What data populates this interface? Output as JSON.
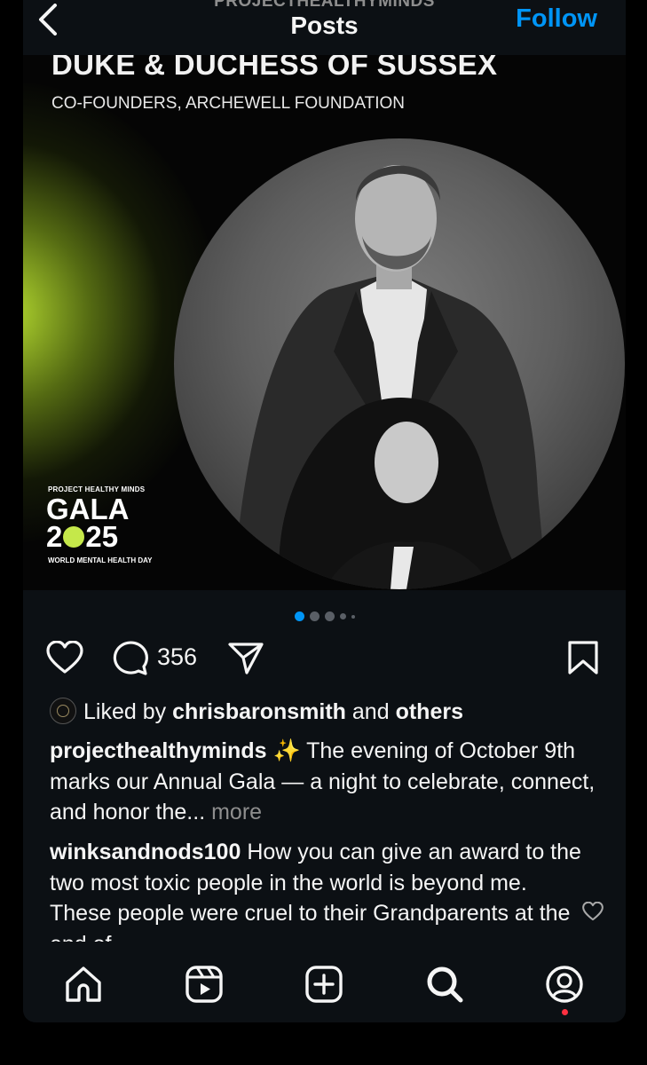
{
  "header": {
    "account_name": "PROJECTHEALTHYMINDS",
    "title": "Posts",
    "follow_label": "Follow"
  },
  "post_image": {
    "title": "DUKE & DUCHESS OF SUSSEX",
    "subtitle": "CO-FOUNDERS, ARCHEWELL FOUNDATION",
    "gala_org": "PROJECT HEALTHY MINDS",
    "gala_word": "GALA",
    "gala_year_a": "2",
    "gala_year_b": "25",
    "gala_tagline": "WORLD MENTAL HEALTH DAY",
    "gala_accent_color": "#c5e84a",
    "glow_color": "#b5dc3a"
  },
  "carousel": {
    "current": 1,
    "total": 5
  },
  "actions": {
    "comment_count": "356",
    "icons": [
      "heart-icon",
      "comment-icon",
      "share-icon",
      "bookmark-icon"
    ]
  },
  "likes": {
    "prefix": "Liked by",
    "user": "chrisbaronsmith",
    "joiner": "and",
    "others": "others"
  },
  "caption": {
    "username": "projecthealthyminds",
    "emoji": "✨",
    "text": "The evening of October 9th marks our Annual Gala — a night to celebrate, connect, and honor the...",
    "more_label": "more"
  },
  "comment": {
    "username": "winksandnods100",
    "text": "How you can give an award to the two most toxic people in the world is beyond me. These people were cruel to their Grandparents at the end of"
  },
  "bottom_nav": {
    "items": [
      "home-icon",
      "reels-icon",
      "create-icon",
      "search-icon",
      "profile-icon"
    ]
  },
  "colors": {
    "background": "#0c1014",
    "link_blue": "#0095f6",
    "muted": "#8e8e8e",
    "notification": "#ff3040"
  }
}
